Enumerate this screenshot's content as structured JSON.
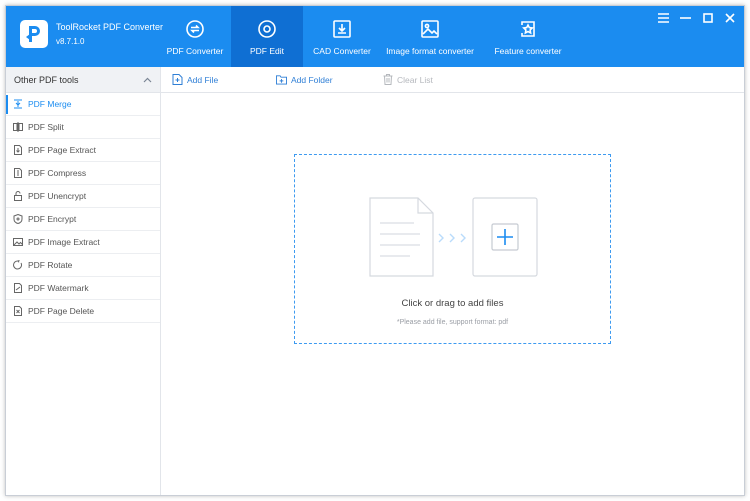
{
  "app": {
    "name": "ToolRocket PDF Converter",
    "version": "v8.7.1.0"
  },
  "colors": {
    "header": "#1b8cf0",
    "active_tab": "#0f6fd3",
    "accent": "#1b8cf0",
    "drop_border": "#3d9af0"
  },
  "nav": {
    "tabs": [
      {
        "label": "PDF Converter",
        "icon": "convert-icon",
        "active": false
      },
      {
        "label": "PDF Edit",
        "icon": "edit-icon",
        "active": true
      },
      {
        "label": "CAD Converter",
        "icon": "cad-icon",
        "active": false
      },
      {
        "label": "Image format converter",
        "icon": "image-icon",
        "active": false
      },
      {
        "label": "Feature converter",
        "icon": "feature-icon",
        "active": false
      }
    ]
  },
  "window_controls": [
    "menu-icon",
    "minimize-icon",
    "maximize-icon",
    "close-icon"
  ],
  "sidebar": {
    "header": "Other PDF tools",
    "items": [
      {
        "label": "PDF Merge",
        "icon": "merge-icon",
        "active": true
      },
      {
        "label": "PDF Split",
        "icon": "split-icon",
        "active": false
      },
      {
        "label": "PDF Page Extract",
        "icon": "page-extract-icon",
        "active": false
      },
      {
        "label": "PDF Compress",
        "icon": "compress-icon",
        "active": false
      },
      {
        "label": "PDF Unencrypt",
        "icon": "unlock-icon",
        "active": false
      },
      {
        "label": "PDF Encrypt",
        "icon": "shield-icon",
        "active": false
      },
      {
        "label": "PDF Image Extract",
        "icon": "image-extract-icon",
        "active": false
      },
      {
        "label": "PDF Rotate",
        "icon": "rotate-icon",
        "active": false
      },
      {
        "label": "PDF Watermark",
        "icon": "watermark-icon",
        "active": false
      },
      {
        "label": "PDF Page Delete",
        "icon": "page-delete-icon",
        "active": false
      }
    ]
  },
  "toolbar": {
    "add_file": "Add File",
    "add_folder": "Add Folder",
    "clear_list": "Clear List"
  },
  "drop_zone": {
    "title": "Click or drag to add files",
    "hint": "*Please add file, support format: pdf"
  }
}
